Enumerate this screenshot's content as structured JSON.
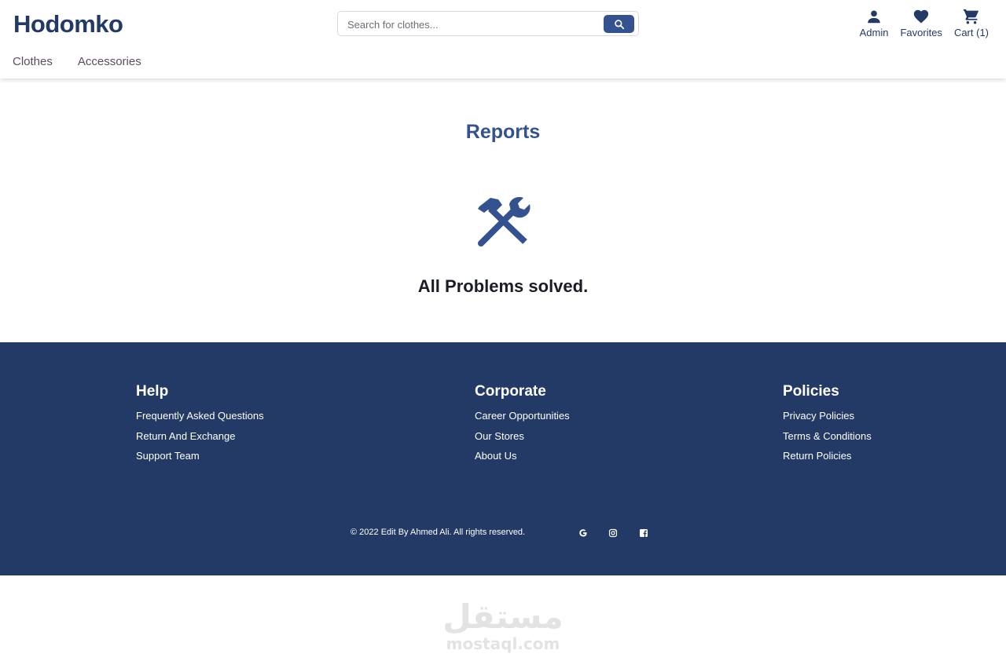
{
  "header": {
    "logo": "Hodomko",
    "search": {
      "placeholder": "Search for clothes...",
      "value": ""
    },
    "nav_icons": [
      {
        "label": "Admin",
        "icon": "user-icon"
      },
      {
        "label": "Favorites",
        "icon": "heart-icon"
      },
      {
        "label": "Cart (1)",
        "icon": "cart-icon"
      }
    ],
    "menu": [
      "Clothes",
      "Accessories"
    ]
  },
  "main": {
    "title": "Reports",
    "icon": "tools-icon",
    "message": "All Problems solved."
  },
  "footer": {
    "columns": [
      {
        "heading": "Help",
        "links": [
          "Frequently Asked Questions",
          "Return And Exchange",
          "Support Team"
        ]
      },
      {
        "heading": "Corporate",
        "links": [
          "Career Opportunities",
          "Our Stores",
          "About Us"
        ]
      },
      {
        "heading": "Policies",
        "links": [
          "Privacy Policies",
          "Terms & Conditions",
          "Return Policies"
        ]
      }
    ],
    "copyright": "© 2022 Edit By Ahmed Ali. All rights reserved.",
    "social": [
      "google-icon",
      "instagram-icon",
      "facebook-icon"
    ]
  },
  "watermark": {
    "arabic": "مستقل",
    "latin": "mostaql.com"
  },
  "colors": {
    "brand": "#233a66",
    "accent": "#34528f",
    "footer_bg": "#233a66"
  }
}
